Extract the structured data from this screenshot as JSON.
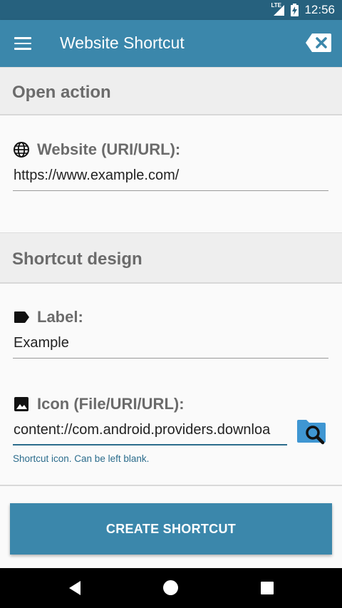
{
  "status_bar": {
    "time": "12:56",
    "network": "LTE"
  },
  "app_bar": {
    "title": "Website Shortcut"
  },
  "sections": {
    "open_action": {
      "title": "Open action"
    },
    "shortcut_design": {
      "title": "Shortcut design"
    }
  },
  "fields": {
    "website": {
      "label": "Website (URI/URL):",
      "value": "https://www.example.com/",
      "icon": "globe-icon"
    },
    "label": {
      "label": "Label:",
      "value": "Example",
      "icon": "label-tag-icon"
    },
    "icon": {
      "label": "Icon (File/URI/URL):",
      "value": "content://com.android.providers.downloa",
      "helper": "Shortcut icon. Can be left blank.",
      "icon": "image-icon"
    }
  },
  "actions": {
    "create": "CREATE SHORTCUT"
  },
  "colors": {
    "primary": "#3b87ab",
    "primary_dark": "#26617e",
    "accent_text": "#2b6c8c"
  }
}
